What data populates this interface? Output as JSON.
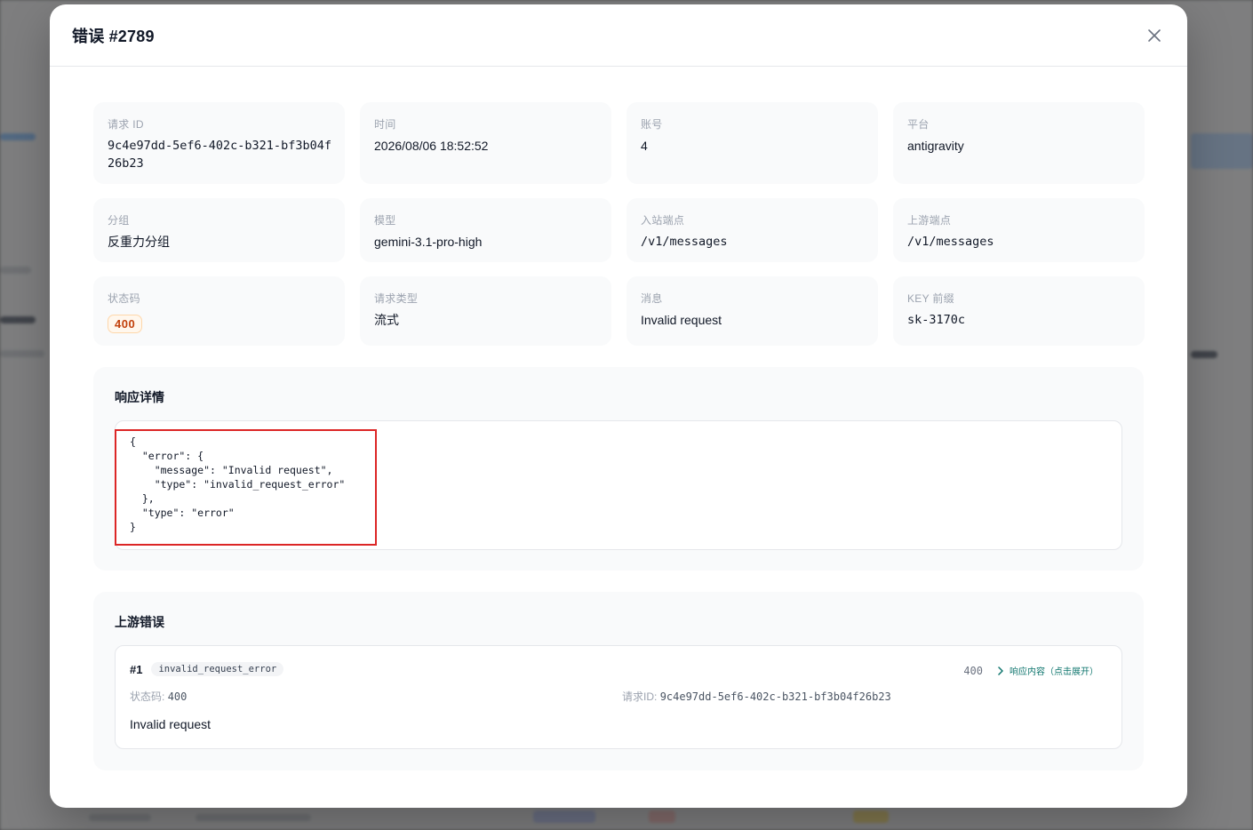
{
  "modal": {
    "title": "错误 #2789"
  },
  "fields": [
    {
      "label": "请求 ID",
      "value": "9c4e97dd-5ef6-402c-b321-bf3b04f26b23",
      "mono": true
    },
    {
      "label": "时间",
      "value": "2026/08/06 18:52:52",
      "mono": false
    },
    {
      "label": "账号",
      "value": "4",
      "mono": false
    },
    {
      "label": "平台",
      "value": "antigravity",
      "mono": false
    },
    {
      "label": "分组",
      "value": "反重力分组",
      "mono": false
    },
    {
      "label": "模型",
      "value": "gemini-3.1-pro-high",
      "mono": false
    },
    {
      "label": "入站端点",
      "value": "/v1/messages",
      "mono": true
    },
    {
      "label": "上游端点",
      "value": "/v1/messages",
      "mono": true
    },
    {
      "label": "状态码",
      "value": "400",
      "mono": false
    },
    {
      "label": "请求类型",
      "value": "流式",
      "mono": false
    },
    {
      "label": "消息",
      "value": "Invalid request",
      "mono": false
    },
    {
      "label": "KEY 前缀",
      "value": "sk-3170c",
      "mono": true
    }
  ],
  "response": {
    "title": "响应详情",
    "body": "{\n  \"error\": {\n    \"message\": \"Invalid request\",\n    \"type\": \"invalid_request_error\"\n  },\n  \"type\": \"error\"\n}"
  },
  "upstream": {
    "title": "上游错误",
    "items": [
      {
        "index": "#1",
        "tag": "invalid_request_error",
        "code": "400",
        "expand_label": "响应内容（点击展开）",
        "status_label": "状态码:",
        "status_value": "400",
        "request_id_label": "请求ID:",
        "request_id_value": "9c4e97dd-5ef6-402c-b321-bf3b04f26b23",
        "message": "Invalid request"
      }
    ]
  },
  "colors": {
    "status_pill_text": "#c2410c",
    "status_pill_bg": "#fff7ed",
    "highlight_border": "#dc2626",
    "expand_link": "#0f766e"
  }
}
